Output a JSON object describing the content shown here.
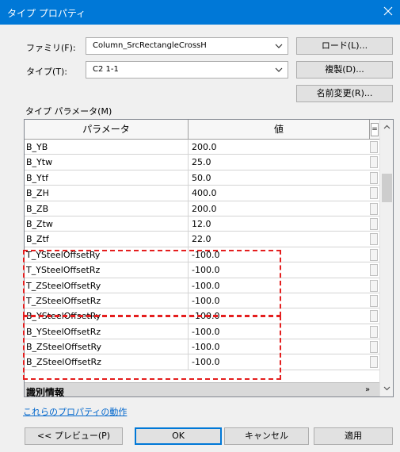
{
  "window": {
    "title": "タイプ プロパティ"
  },
  "family": {
    "label": "ファミリ(F):",
    "value": "Column_SrcRectangleCrossH"
  },
  "type": {
    "label": "タイプ(T):",
    "value": "C2 1-1"
  },
  "buttons": {
    "load": "ロード(L)...",
    "duplicate": "複製(D)...",
    "rename": "名前変更(R)..."
  },
  "type_params_label": "タイプ パラメータ(M)",
  "grid": {
    "headers": {
      "param": "パラメータ",
      "value": "値",
      "eq": "="
    },
    "rows": [
      {
        "name": "B_YB",
        "value": "200.0"
      },
      {
        "name": "B_Ytw",
        "value": "25.0"
      },
      {
        "name": "B_Ytf",
        "value": "50.0"
      },
      {
        "name": "B_ZH",
        "value": "400.0"
      },
      {
        "name": "B_ZB",
        "value": "200.0"
      },
      {
        "name": "B_Ztw",
        "value": "12.0"
      },
      {
        "name": "B_Ztf",
        "value": "22.0"
      },
      {
        "name": "T_YSteelOffsetRy",
        "value": "-100.0"
      },
      {
        "name": "T_YSteelOffsetRz",
        "value": "-100.0"
      },
      {
        "name": "T_ZSteelOffsetRy",
        "value": "-100.0"
      },
      {
        "name": "T_ZSteelOffsetRz",
        "value": "-100.0"
      },
      {
        "name": "B_YSteelOffsetRy",
        "value": "-100.0"
      },
      {
        "name": "B_YSteelOffsetRz",
        "value": "-100.0"
      },
      {
        "name": "B_ZSteelOffsetRy",
        "value": "-100.0"
      },
      {
        "name": "B_ZSteelOffsetRz",
        "value": "-100.0"
      }
    ],
    "group": {
      "name": "識別情報",
      "collapse": "»"
    }
  },
  "link_text": "これらのプロパティの動作",
  "footer": {
    "preview": "<< プレビュー(P)",
    "ok": "OK",
    "cancel": "キャンセル",
    "apply": "適用"
  },
  "colors": {
    "titlebar": "#0078d7",
    "highlight": "#e41e1e",
    "link": "#0066cc"
  }
}
